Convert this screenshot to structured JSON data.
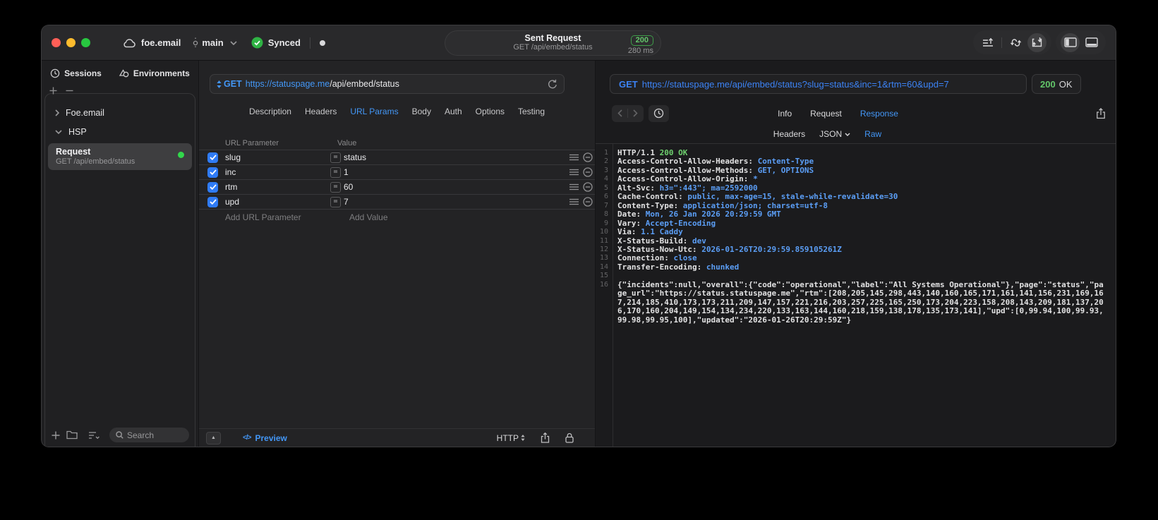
{
  "colors": {
    "accent_blue": "#4397f7",
    "status_green": "#63c76a",
    "sync_green": "#2fb344",
    "record_green": "#32d74b",
    "checkbox_blue": "#2f7bf5",
    "code_value_blue": "#5b9ef6",
    "code_green": "#6ed06e",
    "traffic_red": "#ff5f57",
    "traffic_yellow": "#febc2e",
    "traffic_green": "#28c840"
  },
  "icons": {
    "equals": "=",
    "code": "</>",
    "panel_up": "▲"
  },
  "titlebar": {
    "project": "foe.email",
    "branch": "main",
    "sync_label": "Synced",
    "pill": {
      "title": "Sent Request",
      "subtitle": "GET /api/embed/status",
      "status_code": "200",
      "duration": "280 ms"
    }
  },
  "sidebar": {
    "tabs": [
      {
        "label": "Sessions"
      },
      {
        "label": "Environments"
      }
    ],
    "tree": [
      {
        "label": "Foe.email"
      },
      {
        "label": "HSP"
      }
    ],
    "request_item": {
      "title": "Request",
      "subtitle": "GET /api/embed/status"
    },
    "search_placeholder": "Search"
  },
  "request": {
    "method": "GET",
    "url_host": "https://statuspage.me",
    "url_path": "/api/embed/status",
    "tabs": [
      "Description",
      "Headers",
      "URL Params",
      "Body",
      "Auth",
      "Options",
      "Testing"
    ],
    "active_tab": "URL Params",
    "table": {
      "col_param": "URL Parameter",
      "col_value": "Value",
      "rows": [
        {
          "name": "slug",
          "value": "status",
          "enabled": true
        },
        {
          "name": "inc",
          "value": "1",
          "enabled": true
        },
        {
          "name": "rtm",
          "value": "60",
          "enabled": true
        },
        {
          "name": "upd",
          "value": "7",
          "enabled": true
        }
      ],
      "add_param_placeholder": "Add URL Parameter",
      "add_value_placeholder": "Add Value"
    },
    "footer": {
      "preview_label": "Preview",
      "protocol_label": "HTTP"
    }
  },
  "response": {
    "method": "GET",
    "url": "https://statuspage.me/api/embed/status?slug=status&inc=1&rtm=60&upd=7",
    "status_code": "200",
    "status_text": "OK",
    "tabs": [
      "Info",
      "Request",
      "Response"
    ],
    "active_tab": "Response",
    "subtabs": [
      "Headers",
      "JSON",
      "Raw"
    ],
    "active_subtab": "Raw",
    "lines": [
      {
        "no": "1",
        "name": "HTTP/1.1 ",
        "value": "200 OK"
      },
      {
        "no": "2",
        "name": "Access-Control-Allow-Headers: ",
        "value": "Content-Type"
      },
      {
        "no": "3",
        "name": "Access-Control-Allow-Methods: ",
        "value": "GET, OPTIONS"
      },
      {
        "no": "4",
        "name": "Access-Control-Allow-Origin: ",
        "value": "*"
      },
      {
        "no": "5",
        "name": "Alt-Svc: ",
        "value": "h3=\":443\"; ma=2592000"
      },
      {
        "no": "6",
        "name": "Cache-Control: ",
        "value": "public, max-age=15, stale-while-revalidate=30"
      },
      {
        "no": "7",
        "name": "Content-Type: ",
        "value": "application/json; charset=utf-8"
      },
      {
        "no": "8",
        "name": "Date: ",
        "value": "Mon, 26 Jan 2026 20:29:59 GMT"
      },
      {
        "no": "9",
        "name": "Vary: ",
        "value": "Accept-Encoding"
      },
      {
        "no": "10",
        "name": "Via: ",
        "value": "1.1 Caddy"
      },
      {
        "no": "11",
        "name": "X-Status-Build: ",
        "value": "dev"
      },
      {
        "no": "12",
        "name": "X-Status-Now-Utc: ",
        "value": "2026-01-26T20:29:59.859105261Z"
      },
      {
        "no": "13",
        "name": "Connection: ",
        "value": "close"
      },
      {
        "no": "14",
        "name": "Transfer-Encoding: ",
        "value": "chunked"
      },
      {
        "no": "15",
        "name": "",
        "value": ""
      },
      {
        "no": "16",
        "name": "{\"incidents\":null,\"overall\":{\"code\":\"operational\",\"label\":\"All Systems Operational\"},\"page\":\"status\",\"page_url\":\"https://status.statuspage.me\",\"rtm\":[208,205,145,298,443,140,160,165,171,161,141,156,231,169,167,214,185,410,173,173,211,209,147,157,221,216,203,257,225,165,250,173,204,223,158,208,143,209,181,137,206,170,160,204,149,154,134,234,220,133,163,144,160,218,159,138,178,135,173,141],\"upd\":[0,99.94,100,99.93,99.98,99.95,100],\"updated\":\"2026-01-26T20:29:59Z\"}",
        "value": ""
      }
    ]
  }
}
